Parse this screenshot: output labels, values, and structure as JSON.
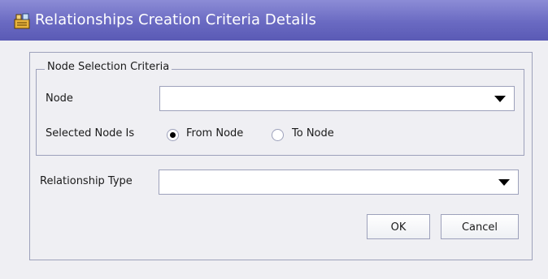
{
  "window": {
    "title": "Relationships Creation Criteria Details",
    "title_icon": "relationship-criteria-icon"
  },
  "node_selection": {
    "legend": "Node Selection Criteria",
    "node_label": "Node",
    "node_value": "",
    "selected_node_label": "Selected Node Is",
    "options": [
      {
        "label": "From Node",
        "selected": true
      },
      {
        "label": "To Node",
        "selected": false
      }
    ]
  },
  "relationship": {
    "type_label": "Relationship Type",
    "type_value": ""
  },
  "buttons": {
    "ok": "OK",
    "cancel": "Cancel"
  },
  "colors": {
    "titlebar": "#6a6ac2",
    "background": "#efeff3",
    "border": "#9da1bb"
  }
}
